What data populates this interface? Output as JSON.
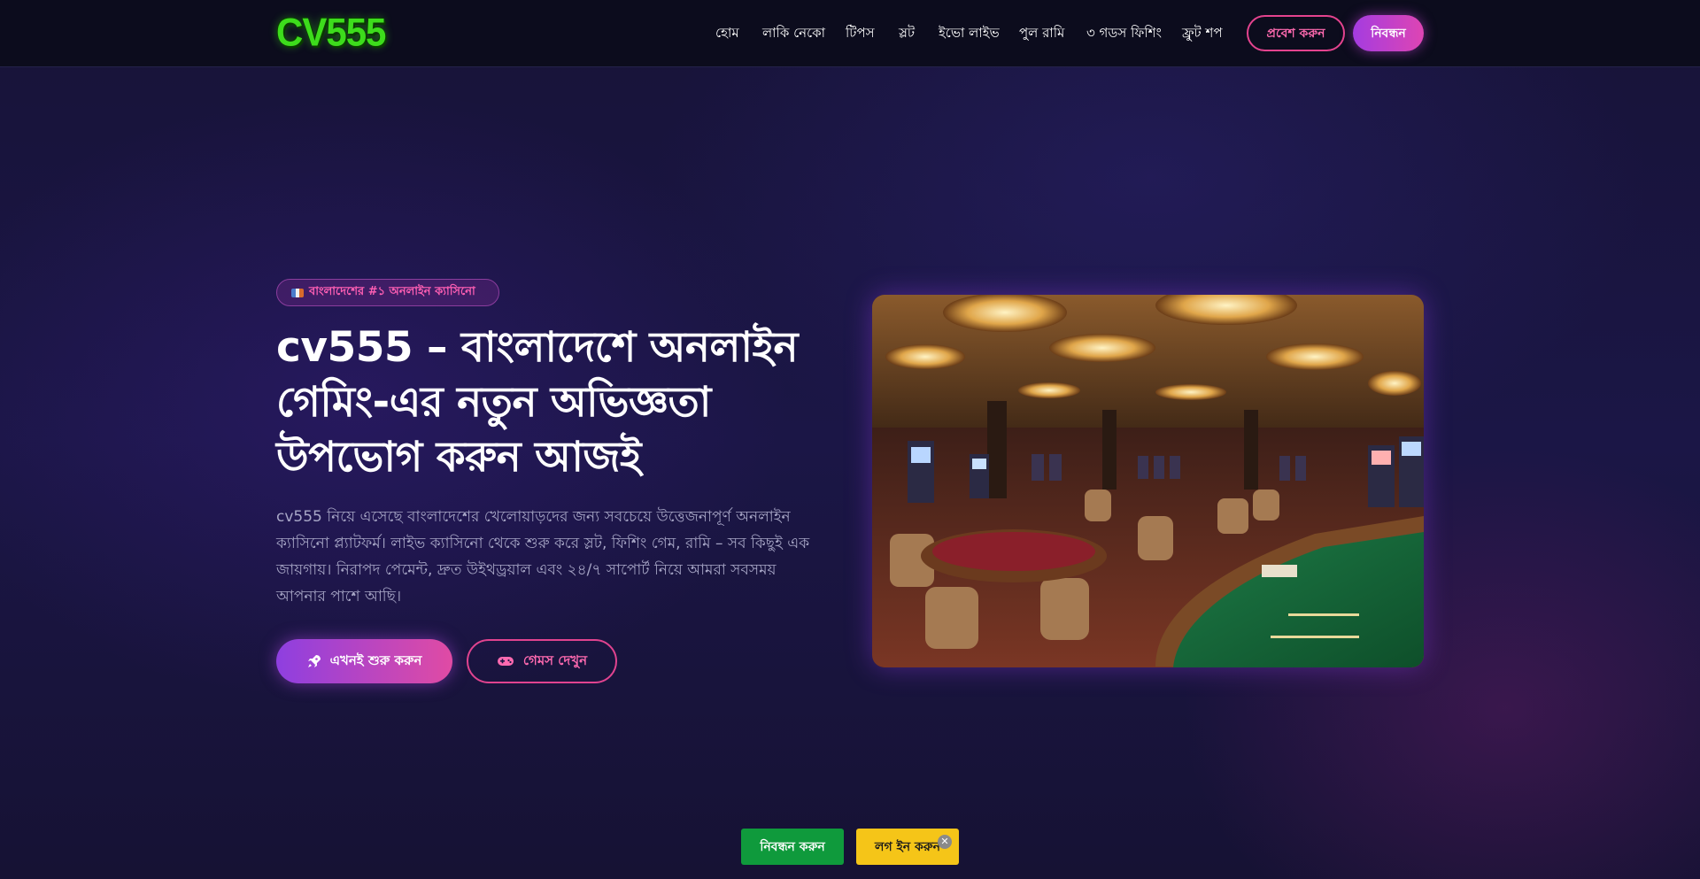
{
  "header": {
    "logo_text": "CV555",
    "nav": [
      {
        "label": "হোম"
      },
      {
        "label": "লাকি নেকো"
      },
      {
        "label": "টিপস"
      },
      {
        "label": "স্লট"
      },
      {
        "label": "ইভো লাইভ"
      },
      {
        "label": "পুল রামি"
      },
      {
        "label": "৩ গডস ফিশিং"
      },
      {
        "label": "ফ্রুট শপ"
      }
    ],
    "login_label": "প্রবেশ করুন",
    "register_label": "নিবন্ধন"
  },
  "hero": {
    "badge": "বাংলাদেশের #১ অনলাইন ক্যাসিনো",
    "title": "cv555 – বাংলাদেশে অনলাইন গেমিং-এর নতুন অভিজ্ঞতা উপভোগ করুন আজই",
    "description": "cv555 নিয়ে এসেছে বাংলাদেশের খেলোয়াড়দের জন্য সবচেয়ে উত্তেজনাপূর্ণ অনলাইন ক্যাসিনো প্ল্যাটফর্ম। লাইভ ক্যাসিনো থেকে শুরু করে স্লট, ফিশিং গেম, রামি – সব কিছুই এক জায়গায়। নিরাপদ পেমেন্ট, দ্রুত উইথড্রয়াল এবং ২৪/৭ সাপোর্ট নিয়ে আমরা সবসময় আপনার পাশে আছি।",
    "start_label": "এখনই শুরু করুন",
    "games_label": "গেমস দেখুন"
  },
  "sticky": {
    "register_label": "নিবন্ধন করুন",
    "login_label": "লগ ইন করুন",
    "close_symbol": "✕"
  },
  "colors": {
    "accent_pink": "#e0438f",
    "accent_purple": "#a43ce0",
    "logo_green": "#3ddc1c",
    "sticky_green": "#0f9a3c",
    "sticky_yellow": "#f5c518"
  },
  "icons": {
    "badge": "flag-icon",
    "start": "rocket-icon",
    "games": "gamepad-icon",
    "close": "close-icon"
  }
}
